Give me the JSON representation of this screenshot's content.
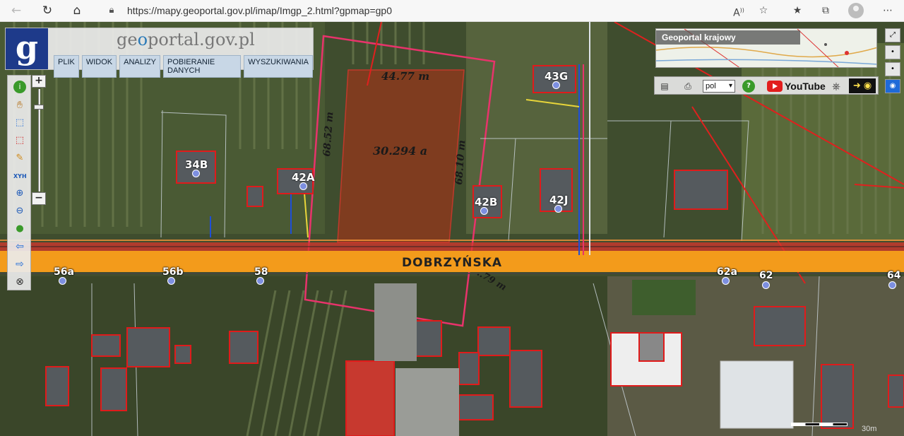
{
  "browser": {
    "url": "https://mapy.geoportal.gov.pl/imap/Imgp_2.html?gpmap=gp0"
  },
  "header": {
    "logo_letter": "g",
    "title_pre": "ge",
    "title_accent": "o",
    "title_post": "portal.gov.pl",
    "menu": [
      "PLIK",
      "WIDOK",
      "ANALIZY",
      "POBIERANIE DANYCH",
      "WYSZUKIWANIA"
    ]
  },
  "left_toolbar": {
    "xyh_label": "XYH"
  },
  "overview": {
    "title": "Geoportal krajowy"
  },
  "right_toolbar": {
    "language": "pol",
    "youtube_label": "YouTube"
  },
  "map": {
    "street_name": "DOBRZYŃSKA",
    "parcel": {
      "area": "30.294 a",
      "top_length": "44.77 m",
      "left_length": "68.52 m",
      "right_length": "68.10 m",
      "bottom_length_partial": "..79 m"
    },
    "address_points": [
      {
        "label": "34B"
      },
      {
        "label": "42A"
      },
      {
        "label": "42B"
      },
      {
        "label": "42J"
      },
      {
        "label": "43G"
      },
      {
        "label": "56a"
      },
      {
        "label": "56b"
      },
      {
        "label": "58"
      },
      {
        "label": "62a"
      },
      {
        "label": "62"
      },
      {
        "label": "64"
      }
    ],
    "scale_label": "30m"
  },
  "colors": {
    "road": "#f39b1b",
    "parcel_fill": "#8b3a1c",
    "boundary": "#e8336b",
    "building": "#e01b1b",
    "geoportal_blue": "#1e3a8a"
  }
}
